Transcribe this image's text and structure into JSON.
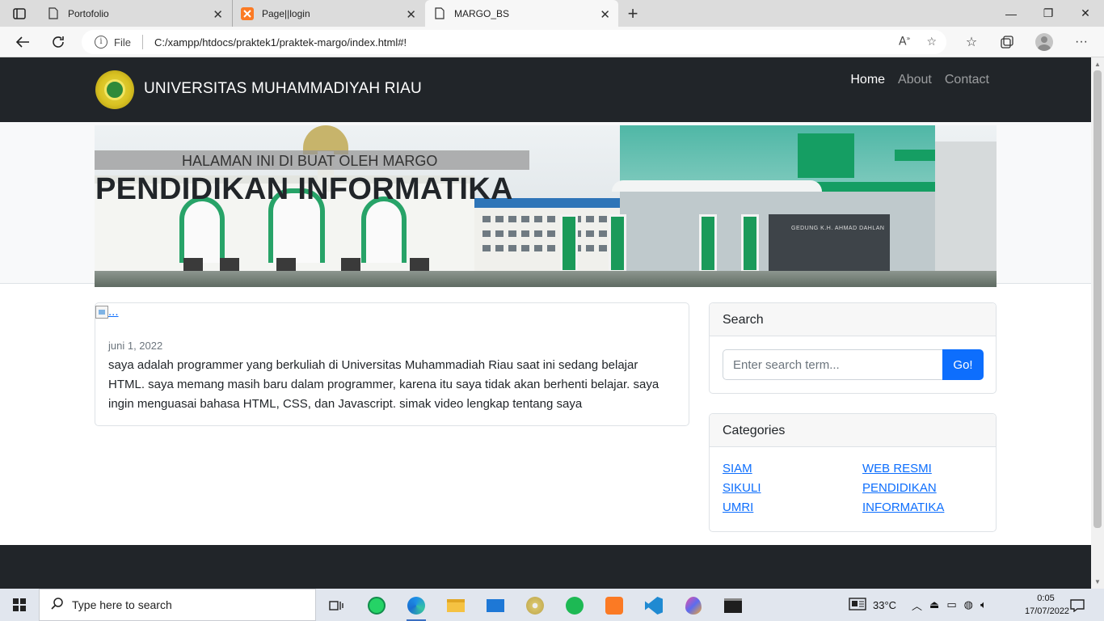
{
  "browser": {
    "tabs": [
      {
        "title": "Portofolio",
        "icon": "page-icon"
      },
      {
        "title": "Page||login",
        "icon": "xampp-icon"
      },
      {
        "title": "MARGO_BS",
        "icon": "page-icon"
      }
    ],
    "address": {
      "scheme_label": "File",
      "url": "C:/xampp/htdocs/praktek1/praktek-margo/index.html#!"
    }
  },
  "site": {
    "brand": "UNIVERSITAS MUHAMMADIYAH RIAU",
    "nav": [
      "Home",
      "About",
      "Contact"
    ],
    "hero": {
      "subtitle": "HALAMAN INI DI BUAT OLEH MARGO",
      "title": "PENDIDIKAN INFORMATIKA",
      "building_sign": "GEDUNG K.H. AHMAD DAHLAN"
    },
    "post": {
      "image_alt": "...",
      "date": "juni 1, 2022",
      "text": "saya adalah programmer yang berkuliah di Universitas Muhammadiah Riau saat ini sedang belajar HTML. saya memang masih baru dalam programmer, karena itu saya tidak akan berhenti belajar. saya ingin menguasai bahasa HTML, CSS, dan Javascript. simak video lengkap tentang saya"
    },
    "search": {
      "header": "Search",
      "placeholder": "Enter search term...",
      "button": "Go!"
    },
    "categories": {
      "header": "Categories",
      "col1": [
        "SIAM",
        "SIKULI",
        "UMRI"
      ],
      "col2": [
        "WEB RESMI",
        "PENDIDIKAN",
        "INFORMATIKA"
      ]
    }
  },
  "taskbar": {
    "search_placeholder": "Type here to search",
    "temperature": "33°C",
    "time": "0:05",
    "date": "17/07/2022"
  },
  "colors": {
    "navbar": "#212529",
    "primary": "#0d6efd"
  }
}
